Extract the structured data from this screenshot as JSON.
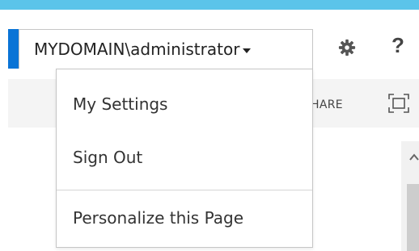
{
  "suite_bar": {
    "user_name": "MYDOMAIN\\administrator",
    "caret_icon": "caret-down-icon",
    "settings_icon": "gear-icon",
    "help_label": "?"
  },
  "ribbon": {
    "share_label": "HARE",
    "focus_icon": "focus-on-content-icon"
  },
  "dropdown": {
    "items": [
      {
        "label": "My Settings"
      },
      {
        "label": "Sign Out"
      },
      {
        "label": "Personalize this Page"
      }
    ]
  },
  "colors": {
    "top_strip": "#5bc4ea",
    "accent": "#0a74d6",
    "ribbon_bg": "#f4f4f4",
    "menu_border": "#c6c6c6"
  }
}
